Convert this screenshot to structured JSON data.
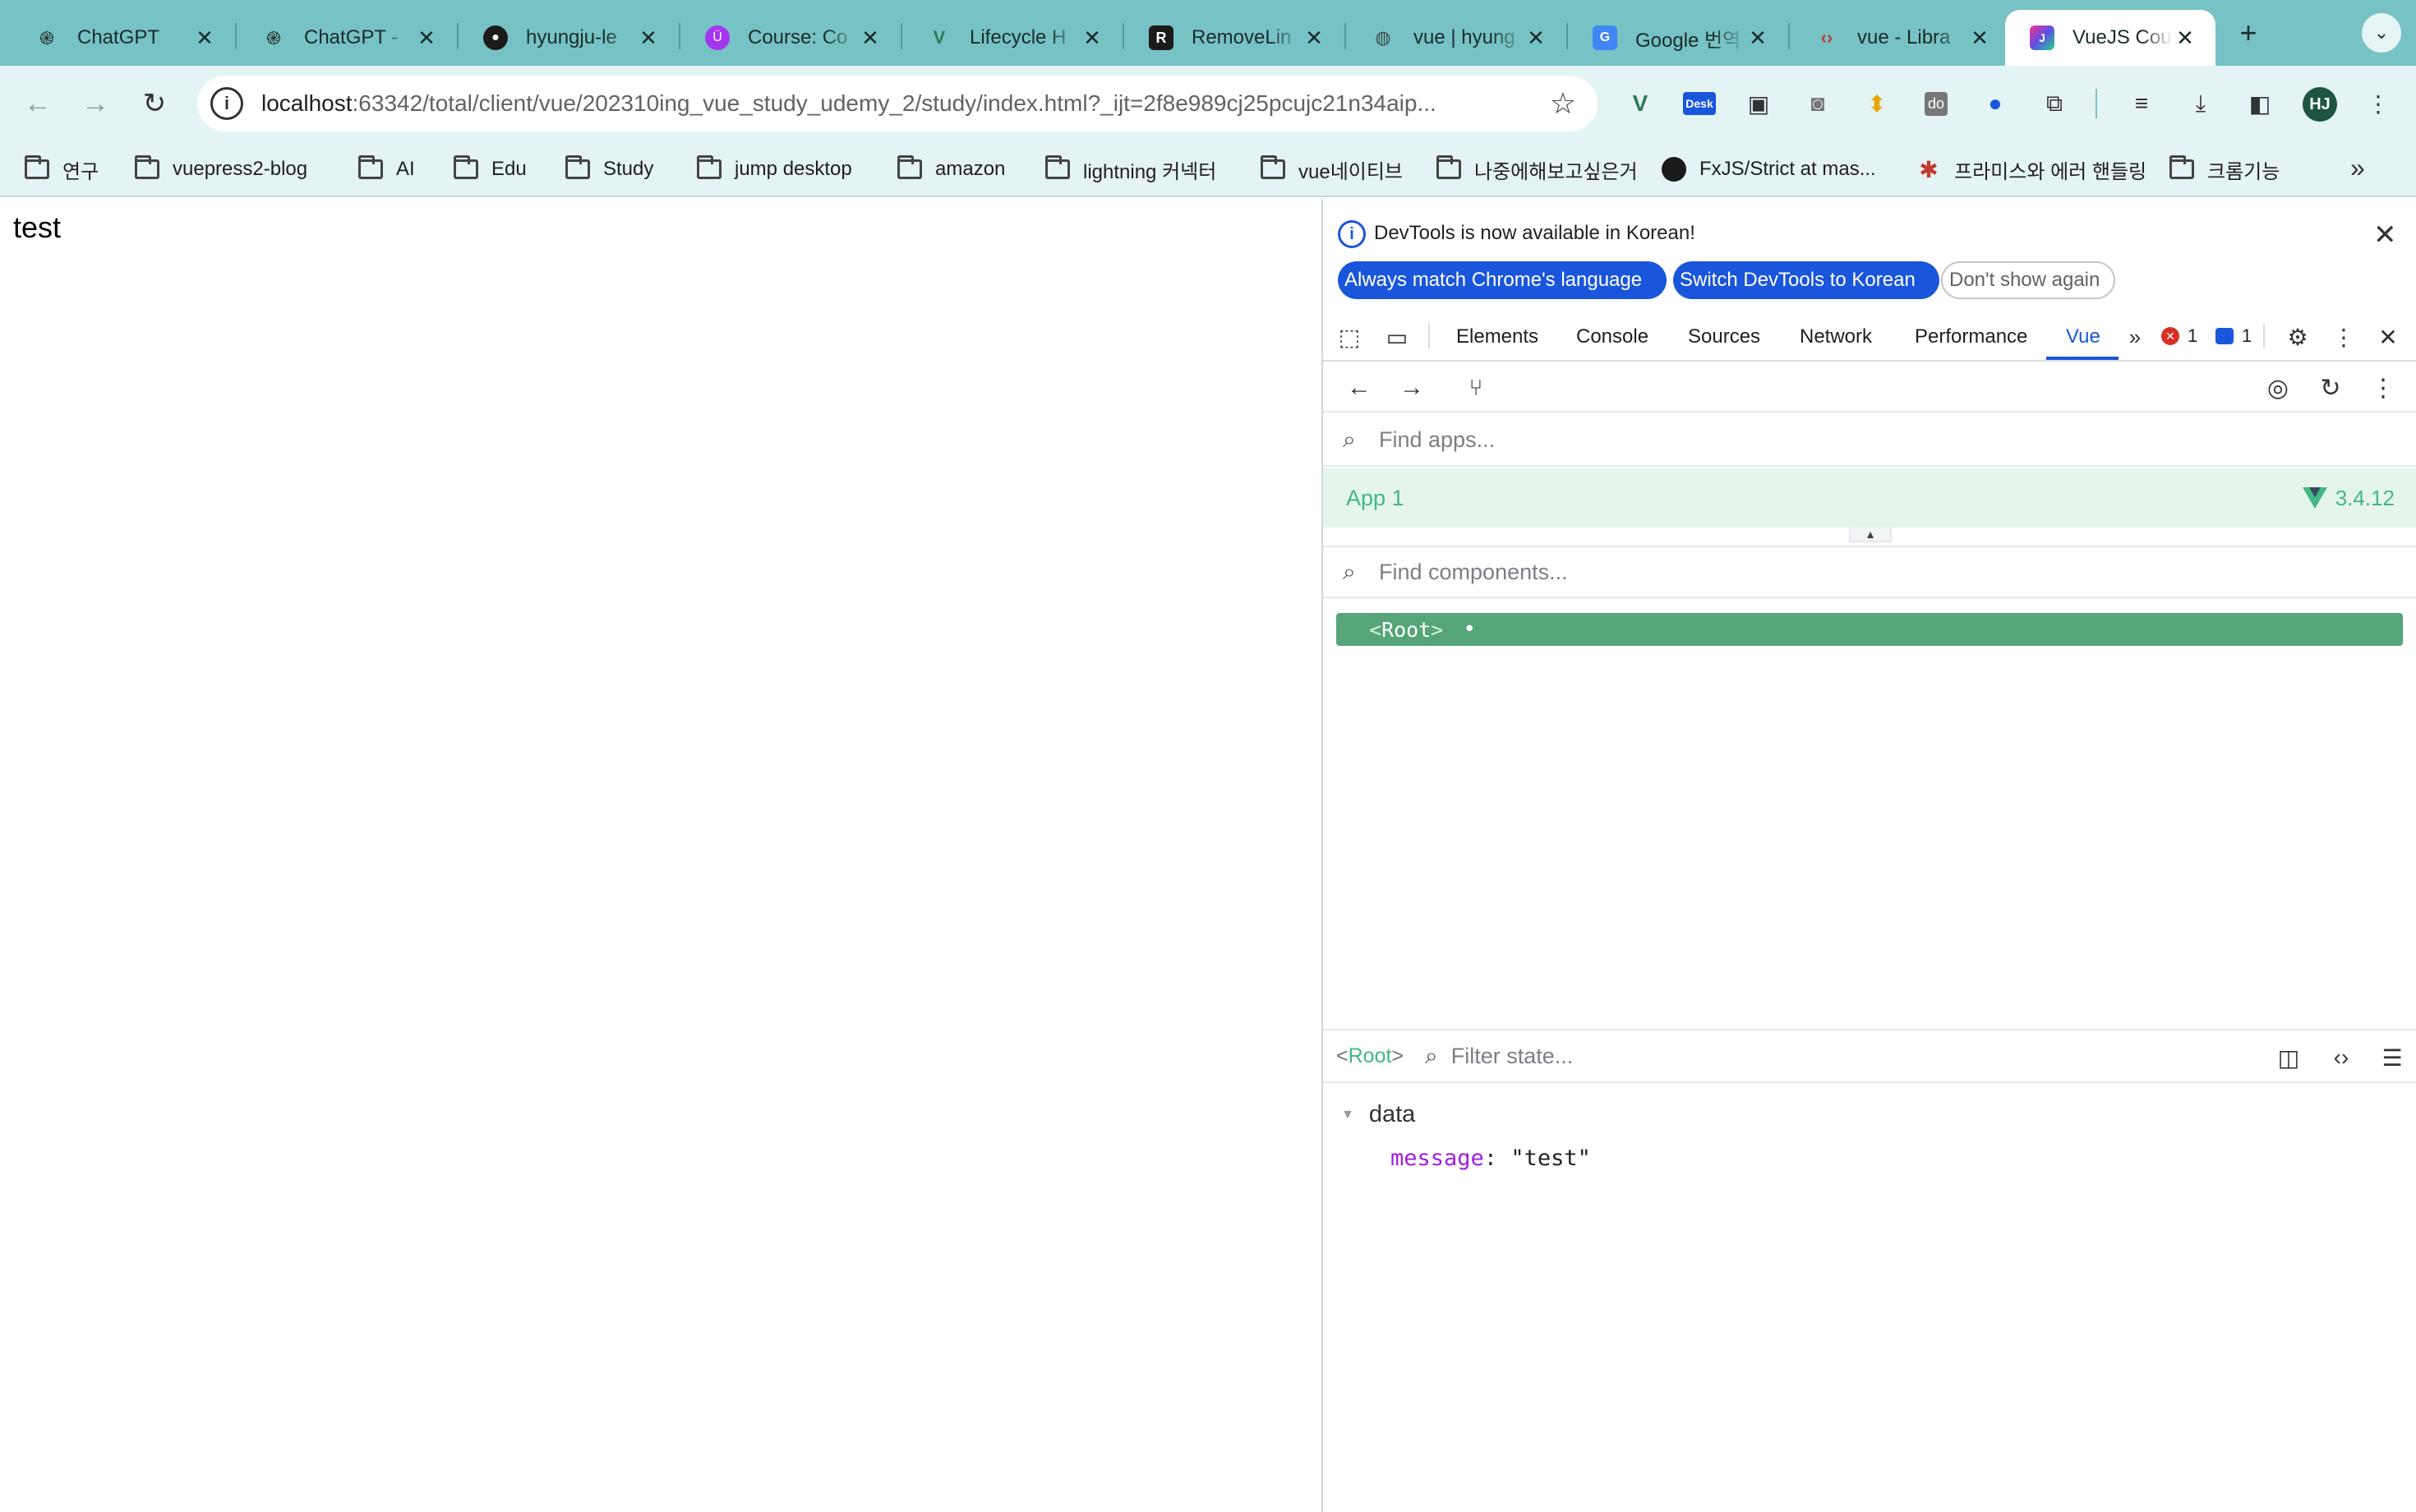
{
  "browser": {
    "tabs": [
      {
        "title": "ChatGPT",
        "icon": "chatgpt-icon"
      },
      {
        "title": "ChatGPT - ",
        "icon": "chatgpt-icon"
      },
      {
        "title": "hyungju-le",
        "icon": "github-icon"
      },
      {
        "title": "Course: Co",
        "icon": "udemy-icon"
      },
      {
        "title": "Lifecycle H",
        "icon": "vue-icon"
      },
      {
        "title": "RemoveLin",
        "icon": "r-icon"
      },
      {
        "title": "vue | hyung",
        "icon": "globe-icon"
      },
      {
        "title": "Google 번역",
        "icon": "google-translate-icon"
      },
      {
        "title": "vue - Libra",
        "icon": "code-icon"
      },
      {
        "title": "VueJS Cou",
        "icon": "jetbrains-icon",
        "active": true
      }
    ],
    "address_bar": {
      "host": "localhost",
      "path": ":63342/total/client/vue/202310ing_vue_study_udemy_2/study/index.html?_ijt=2f8e989cj25pcujc21n34aip..."
    },
    "profile_initials": "HJ",
    "bookmarks": [
      {
        "label": "연구",
        "icon": "folder-icon"
      },
      {
        "label": "vuepress2-blog",
        "icon": "folder-icon"
      },
      {
        "label": "AI",
        "icon": "folder-icon"
      },
      {
        "label": "Edu",
        "icon": "folder-icon"
      },
      {
        "label": "Study",
        "icon": "folder-icon"
      },
      {
        "label": "jump desktop",
        "icon": "folder-icon"
      },
      {
        "label": "amazon",
        "icon": "folder-icon"
      },
      {
        "label": "lightning 커넥터",
        "icon": "folder-icon"
      },
      {
        "label": "vue네이티브",
        "icon": "folder-icon"
      },
      {
        "label": "나중에해보고싶은거",
        "icon": "folder-icon"
      },
      {
        "label": "FxJS/Strict at mas...",
        "icon": "github-icon"
      },
      {
        "label": "프라미스와 에러 핸들링",
        "icon": "figure-icon"
      },
      {
        "label": "크롬기능",
        "icon": "folder-icon"
      }
    ]
  },
  "page": {
    "content_text": "test"
  },
  "devtools": {
    "infobar": {
      "message": "DevTools is now available in Korean!",
      "always_match": "Always match Chrome's language",
      "switch_korean": "Switch DevTools to Korean",
      "dont_show": "Don't show again"
    },
    "tabs": [
      "Elements",
      "Console",
      "Sources",
      "Network",
      "Performance",
      "Vue"
    ],
    "active_tab": "Vue",
    "error_count": "1",
    "message_count": "1",
    "vue": {
      "find_apps_placeholder": "Find apps...",
      "app_name": "App 1",
      "vue_version": "3.4.12",
      "find_components_placeholder": "Find components...",
      "root_component": "Root",
      "selected_component": "Root",
      "filter_state_placeholder": "Filter state...",
      "data_section_label": "data",
      "state": {
        "key": "message",
        "value": "\"test\""
      }
    }
  },
  "colors": {
    "tab_strip": "#76c2c4",
    "toolbar": "#e4f3f4",
    "vue_green": "#41b883",
    "tree_selected": "#56a579",
    "devtools_blue": "#1a56db"
  }
}
